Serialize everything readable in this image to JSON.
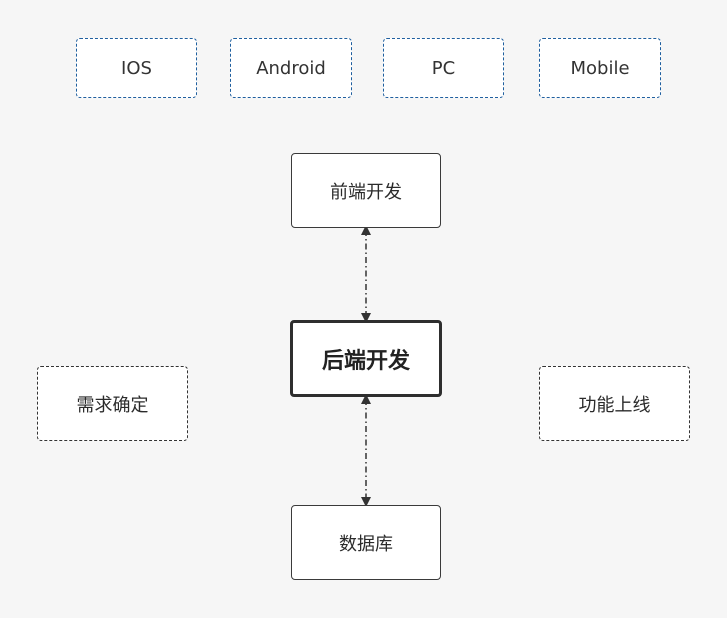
{
  "platforms": [
    "IOS",
    "Android",
    "PC",
    "Mobile"
  ],
  "nodes": {
    "frontend": "前端开发",
    "backend": "后端开发",
    "database": "数据库",
    "requirements": "需求确定",
    "launch": "功能上线"
  },
  "colors": {
    "background": "#f6f6f6",
    "platform_border": "#1f5f9f",
    "node_border": "#3a3a3a",
    "connector": "#333333"
  }
}
